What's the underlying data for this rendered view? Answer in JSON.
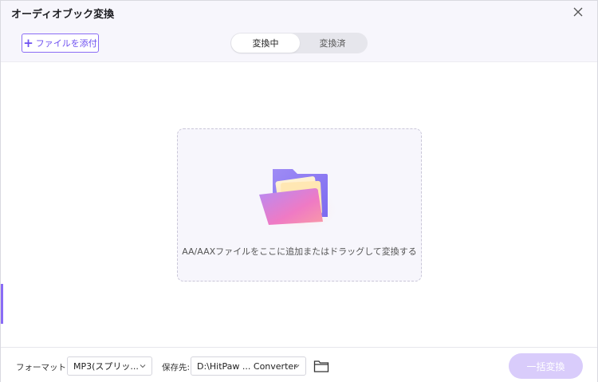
{
  "window": {
    "title": "オーディオブック変換"
  },
  "toolbar": {
    "add_file_label": "ファイルを添付"
  },
  "tabs": [
    {
      "label": "変換中",
      "active": true
    },
    {
      "label": "変換済",
      "active": false
    }
  ],
  "dropzone": {
    "text": "AA/AAXファイルをここに追加またはドラッグして変換する"
  },
  "footer": {
    "format_label": "フォーマット:",
    "format_value": "MP3(スプリッ...",
    "save_label": "保存先:",
    "save_value": "D:\\HitPaw ... Converter",
    "convert_all_label": "一括変換"
  },
  "colors": {
    "accent": "#6d4ff0",
    "convert_disabled": "#d9ccfb"
  },
  "icons": [
    "close-icon",
    "plus-icon",
    "folder-illustration-icon",
    "chevron-down-icon",
    "folder-icon"
  ]
}
